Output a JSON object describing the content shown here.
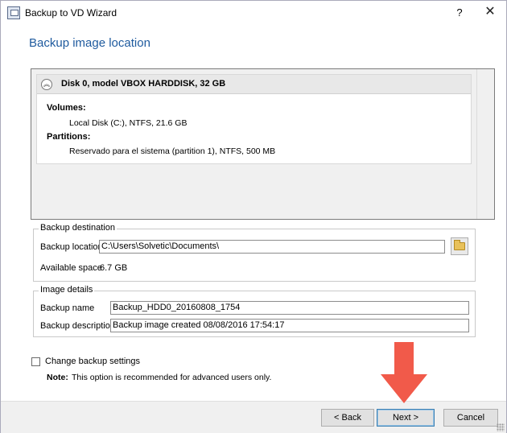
{
  "window": {
    "title": "Backup to VD Wizard"
  },
  "titlebar": {
    "help_glyph": "?",
    "close_glyph": "✕"
  },
  "heading": "Backup image location",
  "disk": {
    "collapse_glyph": "︽",
    "title": "Disk 0, model VBOX HARDDISK, 32 GB",
    "volumes_label": "Volumes:",
    "volumes": [
      "Local Disk (C:), NTFS, 21.6 GB"
    ],
    "partitions_label": "Partitions:",
    "partitions": [
      "Reservado para el sistema (partition 1), NTFS, 500 MB"
    ]
  },
  "backup_destination": {
    "group_label": "Backup destination",
    "location_label": "Backup location",
    "location_value": "C:\\Users\\Solvetic\\Documents\\",
    "browse_icon": "folder-icon",
    "available_label": "Available space",
    "available_value": "6.7 GB"
  },
  "image_details": {
    "group_label": "Image details",
    "name_label": "Backup name",
    "name_value": "Backup_HDD0_20160808_1754",
    "description_label": "Backup description",
    "description_value": "Backup image created 08/08/2016 17:54:17"
  },
  "options": {
    "change_settings_label": "Change backup settings",
    "change_settings_checked": false,
    "note_label": "Note:",
    "note_text": "This option is recommended for advanced users only."
  },
  "buttons": {
    "back": "< Back",
    "next": "Next >",
    "cancel": "Cancel"
  },
  "colors": {
    "heading": "#1e5a9e",
    "arrow": "#f15a4a"
  }
}
